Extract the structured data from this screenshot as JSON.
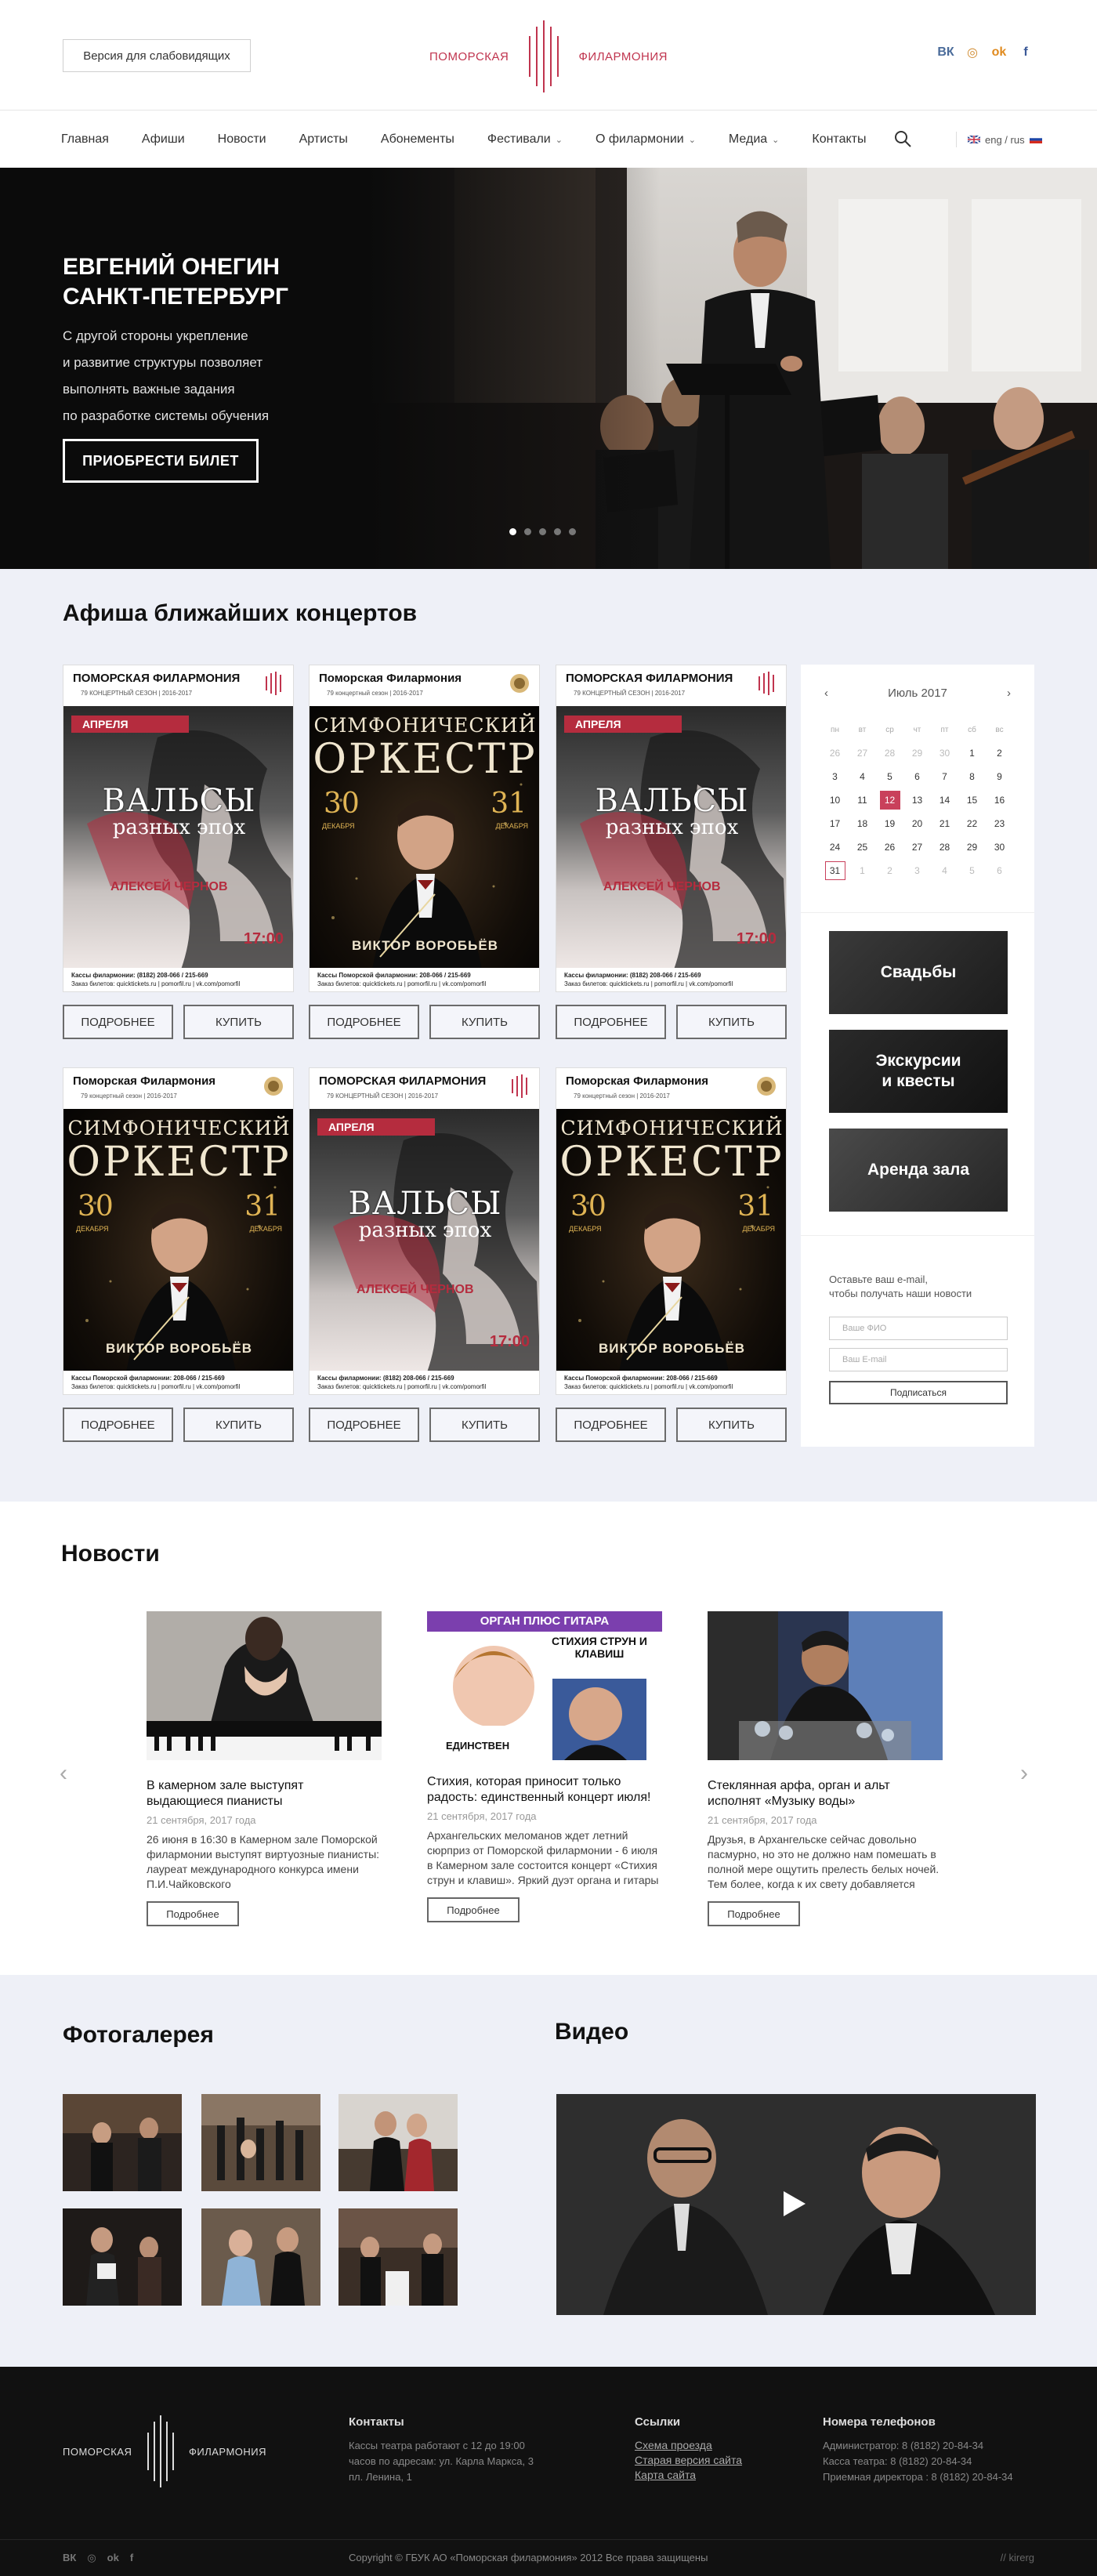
{
  "header": {
    "accessibility_label": "Версия для слабовидящих",
    "logo_left": "ПОМОРСКАЯ",
    "logo_right": "ФИЛАРМОНИЯ",
    "social": [
      {
        "icon": "vk-icon",
        "glyph": "ВК",
        "color": "#4a6b9a"
      },
      {
        "icon": "instagram-icon",
        "glyph": "◎",
        "color": "#d08a2e"
      },
      {
        "icon": "odnoklassniki-icon",
        "glyph": "ok",
        "color": "#e08a1e"
      },
      {
        "icon": "facebook-icon",
        "glyph": "f",
        "color": "#3b5998"
      }
    ]
  },
  "nav": {
    "items": [
      {
        "label": "Главная",
        "dropdown": false
      },
      {
        "label": "Афиши",
        "dropdown": false
      },
      {
        "label": "Новости",
        "dropdown": false
      },
      {
        "label": "Артисты",
        "dropdown": false
      },
      {
        "label": "Абонементы",
        "dropdown": false
      },
      {
        "label": "Фестивали",
        "dropdown": true
      },
      {
        "label": "О филармонии",
        "dropdown": true
      },
      {
        "label": "Медиа",
        "dropdown": true
      },
      {
        "label": "Контакты",
        "dropdown": false
      }
    ],
    "lang": "eng / rus"
  },
  "hero": {
    "title": "ЕВГЕНИЙ ОНЕГИН\nСАНКТ-ПЕТЕРБУРГ",
    "subtitle": "С другой стороны укрепление\nи развитие структуры позволяет\nвыполнять важные задания\nпо разработке системы обучения",
    "button": "ПРИОБРЕСТИ БИЛЕТ",
    "slides": 5,
    "active_slide": 1
  },
  "afisha": {
    "title": "Афиша ближайших концертов",
    "more_label": "ПОДРОБНЕЕ",
    "buy_label": "КУПИТЬ",
    "posters": [
      {
        "kind": "waltz",
        "org": "ПОМОРСКАЯ ФИЛАРМОНИЯ",
        "season": "79 КОНЦЕРТНЫЙ СЕЗОН | 2016-2017",
        "month": "АПРЕЛЯ",
        "title1": "ВАЛЬСЫ",
        "title2": "разных эпох",
        "performer": "АЛЕКСЕЙ ЧЕРНОВ",
        "time": "17:00",
        "foot1": "Кассы филармонии: (8182) 208-066 / 215-669",
        "foot2": "Заказ билетов: quicktickets.ru | pomorfil.ru | vk.com/pomorfil"
      },
      {
        "kind": "orch",
        "org": "Поморская Филармония",
        "season": "79 концертный сезон | 2016-2017",
        "title1": "СИМФОНИЧЕСКИЙ",
        "title2": "ОРКЕСТР",
        "d1": "30",
        "d2": "31",
        "dm": "ДЕКАБРЯ",
        "conductor": "ВИКТОР ВОРОБЬЁВ",
        "foot1": "Кассы Поморской филармонии: 208-066 / 215-669",
        "foot2": "Заказ билетов: quicktickets.ru | pomorfil.ru | vk.com/pomorfil"
      },
      {
        "kind": "waltz",
        "org": "ПОМОРСКАЯ ФИЛАРМОНИЯ",
        "season": "79 КОНЦЕРТНЫЙ СЕЗОН | 2016-2017",
        "month": "АПРЕЛЯ",
        "title1": "ВАЛЬСЫ",
        "title2": "разных эпох",
        "performer": "АЛЕКСЕЙ ЧЕРНОВ",
        "time": "17:00",
        "foot1": "Кассы филармонии: (8182) 208-066 / 215-669",
        "foot2": "Заказ билетов: quicktickets.ru | pomorfil.ru | vk.com/pomorfil"
      },
      {
        "kind": "orch",
        "org": "Поморская Филармония",
        "season": "79 концертный сезон | 2016-2017",
        "title1": "СИМФОНИЧЕСКИЙ",
        "title2": "ОРКЕСТР",
        "d1": "30",
        "d2": "31",
        "dm": "ДЕКАБРЯ",
        "conductor": "ВИКТОР ВОРОБЬЁВ",
        "foot1": "Кассы Поморской филармонии: 208-066 / 215-669",
        "foot2": "Заказ билетов: quicktickets.ru | pomorfil.ru | vk.com/pomorfil"
      },
      {
        "kind": "waltz",
        "org": "ПОМОРСКАЯ ФИЛАРМОНИЯ",
        "season": "79 КОНЦЕРТНЫЙ СЕЗОН | 2016-2017",
        "month": "АПРЕЛЯ",
        "title1": "ВАЛЬСЫ",
        "title2": "разных эпох",
        "performer": "АЛЕКСЕЙ ЧЕРНОВ",
        "time": "17:00",
        "foot1": "Кассы филармонии: (8182) 208-066 / 215-669",
        "foot2": "Заказ билетов: quicktickets.ru | pomorfil.ru | vk.com/pomorfil"
      },
      {
        "kind": "orch",
        "org": "Поморская Филармония",
        "season": "79 концертный сезон | 2016-2017",
        "title1": "СИМФОНИЧЕСКИЙ",
        "title2": "ОРКЕСТР",
        "d1": "30",
        "d2": "31",
        "dm": "ДЕКАБРЯ",
        "conductor": "ВИКТОР ВОРОБЬЁВ",
        "foot1": "Кассы Поморской филармонии: 208-066 / 215-669",
        "foot2": "Заказ билетов: quicktickets.ru | pomorfil.ru | vk.com/pomorfil"
      }
    ]
  },
  "calendar": {
    "month": "Июль 2017",
    "prev": "‹",
    "next": "›",
    "weekdays": [
      "пн",
      "вт",
      "ср",
      "чт",
      "пт",
      "сб",
      "вс"
    ],
    "weeks": [
      [
        {
          "d": "26",
          "m": true
        },
        {
          "d": "27",
          "m": true
        },
        {
          "d": "28",
          "m": true
        },
        {
          "d": "29",
          "m": true
        },
        {
          "d": "30",
          "m": true
        },
        {
          "d": "1"
        },
        {
          "d": "2"
        }
      ],
      [
        {
          "d": "3"
        },
        {
          "d": "4"
        },
        {
          "d": "5"
        },
        {
          "d": "6"
        },
        {
          "d": "7"
        },
        {
          "d": "8"
        },
        {
          "d": "9"
        }
      ],
      [
        {
          "d": "10"
        },
        {
          "d": "11"
        },
        {
          "d": "12",
          "today": true
        },
        {
          "d": "13"
        },
        {
          "d": "14"
        },
        {
          "d": "15"
        },
        {
          "d": "16"
        }
      ],
      [
        {
          "d": "17"
        },
        {
          "d": "18"
        },
        {
          "d": "19"
        },
        {
          "d": "20"
        },
        {
          "d": "21"
        },
        {
          "d": "22"
        },
        {
          "d": "23"
        }
      ],
      [
        {
          "d": "24"
        },
        {
          "d": "25"
        },
        {
          "d": "26"
        },
        {
          "d": "27"
        },
        {
          "d": "28"
        },
        {
          "d": "29"
        },
        {
          "d": "30"
        }
      ],
      [
        {
          "d": "31",
          "sel": true
        },
        {
          "d": "1",
          "m": true
        },
        {
          "d": "2",
          "m": true
        },
        {
          "d": "3",
          "m": true
        },
        {
          "d": "4",
          "m": true
        },
        {
          "d": "5",
          "m": true
        },
        {
          "d": "6",
          "m": true
        }
      ]
    ]
  },
  "side_tiles": [
    "Свадьбы",
    "Экскурсии\nи квесты",
    "Аренда зала"
  ],
  "subscribe": {
    "text": "Оставьте ваш e-mail,\nчтобы получать наши новости",
    "name_placeholder": "Ваше ФИО",
    "email_placeholder": "Ваш E-mail",
    "button": "Подписаться"
  },
  "news": {
    "title": "Новости",
    "more_label": "Подробнее",
    "items": [
      {
        "title": "В камерном зале выступят выдающиеся пианисты",
        "date": "21 сентября, 2017 года",
        "text": "26 июня в 16:30 в Камерном зале Поморской филармонии выступят виртуозные пианисты: лауреат международного конкурса имени П.И.Чайковского"
      },
      {
        "title": "Стихия, которая приносит только радость: единственный концерт июля!",
        "date": "21 сентября, 2017 года",
        "text": "Архангельских меломанов ждет летний сюрприз от Поморской филармонии - 6 июля в Камерном зале состоится концерт «Стихия струн и клавиш». Яркий дуэт органа и гитары",
        "img_top": "ОРГАН ПЛЮС ГИТАРА",
        "img_mid": "СТИХИЯ СТРУН И КЛАВИШ",
        "img_bottom": "ЕДИНСТВЕН"
      },
      {
        "title": "Стеклянная арфа, орган и альт исполнят «Музыку воды»",
        "date": "21 сентября, 2017 года",
        "text": "Друзья, в Архангельске сейчас довольно пасмурно, но это не должно нам помешать в полной мере ощутить прелесть белых ночей. Тем более, когда к их свету добавляется"
      }
    ]
  },
  "gallery": {
    "title": "Фотогалерея"
  },
  "video": {
    "title": "Видео"
  },
  "footer": {
    "logo_left": "ПОМОРСКАЯ",
    "logo_right": "ФИЛАРМОНИЯ",
    "contacts_title": "Контакты",
    "contacts_text": "Кассы театра работают с 12 до 19:00\nчасов по адресам: ул. Карла Маркса, 3\nпл. Ленина, 1",
    "links_title": "Ссылки",
    "links": [
      "Схема проезда",
      "Старая версия сайта",
      "Карта сайта"
    ],
    "phones_title": "Номера телефонов",
    "phones": [
      "Администратор: 8 (8182) 20-84-34",
      "Касса театра: 8 (8182) 20-84-34",
      "Приемная директора : 8 (8182) 20-84-34"
    ],
    "copyright": "Copyright © ГБУК АО «Поморская филармония» 2012 Все права защищены",
    "developer": "// kirerg",
    "social": [
      "ВК",
      "◎",
      "ok",
      "f"
    ]
  }
}
